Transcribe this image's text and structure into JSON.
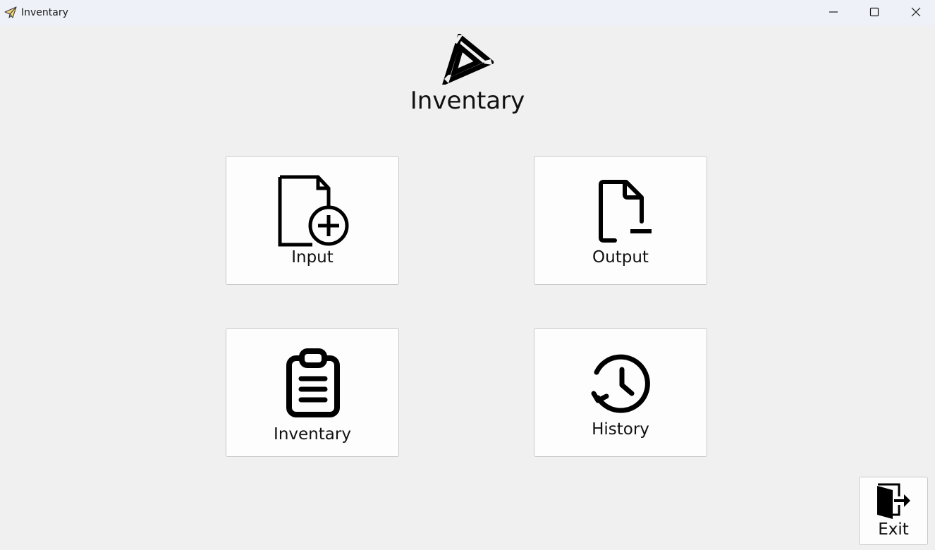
{
  "window": {
    "title": "Inventary",
    "controls": {
      "minimize": "minimize-icon",
      "maximize": "maximize-icon",
      "close": "close-icon"
    }
  },
  "header": {
    "logo": "triangle-logo",
    "title": "Inventary"
  },
  "tiles": [
    {
      "label": "Input",
      "icon": "document-add-icon"
    },
    {
      "label": "Output",
      "icon": "document-remove-icon"
    },
    {
      "label": "Inventary",
      "icon": "clipboard-list-icon"
    },
    {
      "label": "History",
      "icon": "history-icon"
    }
  ],
  "exit": {
    "label": "Exit",
    "icon": "exit-door-icon"
  }
}
